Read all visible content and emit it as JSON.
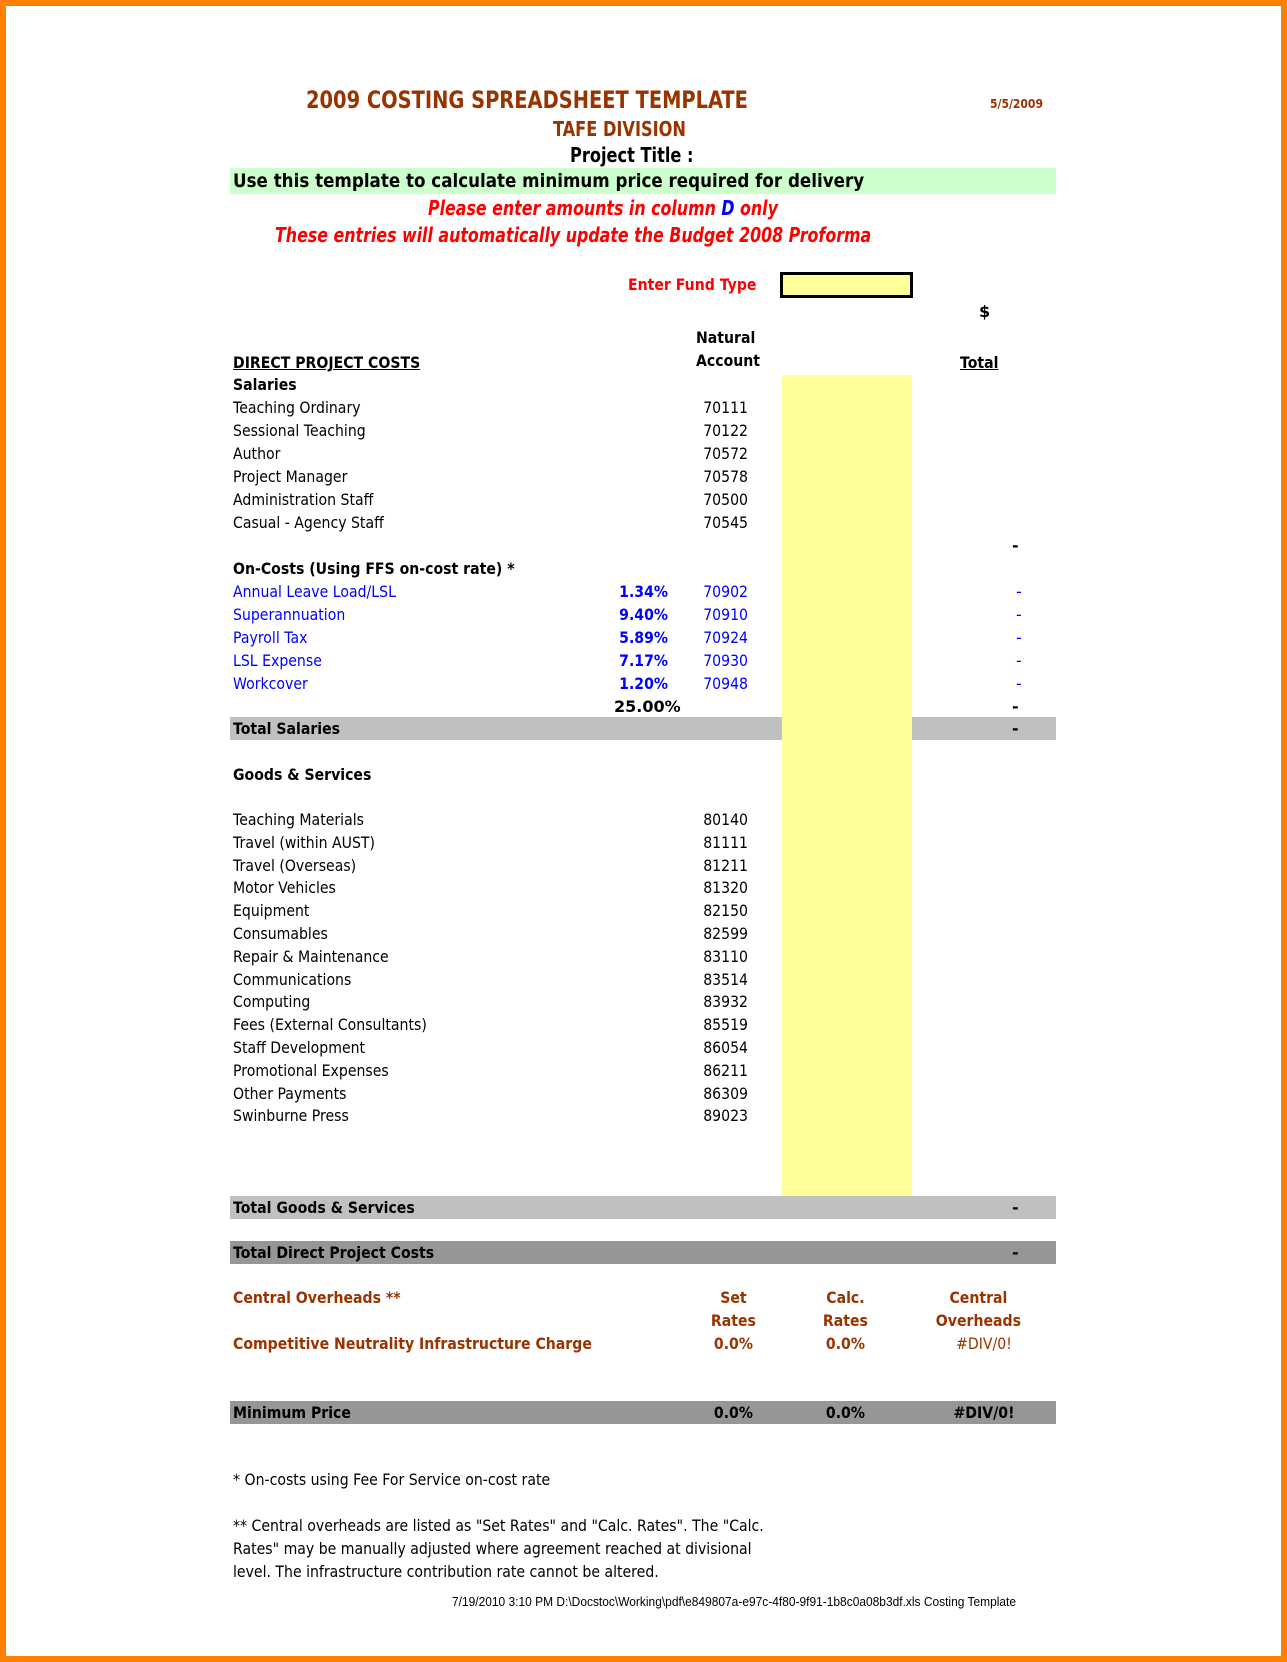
{
  "header": {
    "title": "2009 COSTING SPREADSHEET TEMPLATE",
    "date": "5/5/2009",
    "division": "TAFE DIVISION",
    "project_title_label": "Project Title :",
    "banner": "Use this template to calculate minimum price required for delivery",
    "instruction_prefix": "Please enter amounts in column",
    "instruction_column": "D",
    "instruction_suffix": "only",
    "instruction_2": "These entries will automatically update the Budget 2008 Proforma"
  },
  "fund_type": {
    "label": "Enter Fund Type",
    "value": ""
  },
  "columns": {
    "currency": "$",
    "natural_line1": "Natural",
    "natural_line2": "Account",
    "total": "Total"
  },
  "direct_costs": {
    "heading": "DIRECT PROJECT COSTS",
    "salaries": {
      "heading": "Salaries",
      "items": [
        {
          "label": "Teaching  Ordinary",
          "account": "70111"
        },
        {
          "label": "Sessional Teaching",
          "account": "70122"
        },
        {
          "label": "Author",
          "account": "70572"
        },
        {
          "label": "Project Manager",
          "account": "70578"
        },
        {
          "label": "Administration Staff",
          "account": "70500"
        },
        {
          "label": "Casual - Agency Staff",
          "account": "70545"
        }
      ],
      "subtotal": "-"
    },
    "oncosts": {
      "heading": "On-Costs (Using FFS on-cost rate) *",
      "items": [
        {
          "label": "Annual Leave Load/LSL",
          "rate": "1.34%",
          "account": "70902",
          "total": "-"
        },
        {
          "label": "Superannuation",
          "rate": "9.40%",
          "account": "70910",
          "total": "-"
        },
        {
          "label": "Payroll Tax",
          "rate": "5.89%",
          "account": "70924",
          "total": "-"
        },
        {
          "label": "LSL Expense",
          "rate": "7.17%",
          "account": "70930",
          "total": "-"
        },
        {
          "label": "Workcover",
          "rate": "1.20%",
          "account": "70948",
          "total": "-"
        }
      ],
      "rate_total": "25.00%",
      "subtotal": "-"
    },
    "total_salaries": {
      "label": "Total Salaries",
      "value": "-"
    },
    "goods": {
      "heading": "Goods & Services",
      "items": [
        {
          "label": "Teaching Materials",
          "account": "80140"
        },
        {
          "label": "Travel (within AUST)",
          "account": "81111"
        },
        {
          "label": "Travel (Overseas)",
          "account": "81211"
        },
        {
          "label": "Motor Vehicles",
          "account": "81320"
        },
        {
          "label": "Equipment",
          "account": "82150"
        },
        {
          "label": "Consumables",
          "account": "82599"
        },
        {
          "label": "Repair & Maintenance",
          "account": "83110"
        },
        {
          "label": "Communications",
          "account": "83514"
        },
        {
          "label": "Computing",
          "account": "83932"
        },
        {
          "label": "Fees (External Consultants)",
          "account": "85519"
        },
        {
          "label": "Staff Development",
          "account": "86054"
        },
        {
          "label": "Promotional Expenses",
          "account": "86211"
        },
        {
          "label": "Other Payments",
          "account": "86309"
        },
        {
          "label": "Swinburne Press",
          "account": "89023"
        }
      ]
    },
    "total_goods": {
      "label": "Total Goods & Services",
      "value": "-"
    },
    "total_direct": {
      "label": "Total Direct Project Costs",
      "value": "-"
    }
  },
  "overheads": {
    "heading": "Central Overheads **",
    "col_set_1": "Set",
    "col_set_2": "Rates",
    "col_calc_1": "Calc.",
    "col_calc_2": "Rates",
    "col_central_1": "Central",
    "col_central_2": "Overheads",
    "row": {
      "label": "Competitive Neutrality Infrastructure Charge",
      "set_rate": "0.0%",
      "calc_rate": "0.0%",
      "central": "#DIV/0!"
    }
  },
  "minimum_price": {
    "label": "Minimum Price",
    "set_rate": "0.0%",
    "calc_rate": "0.0%",
    "value": "#DIV/0!"
  },
  "notes": {
    "note1": "*  On-costs using Fee For Service on-cost rate",
    "note2_line1": "** Central overheads are listed as \"Set Rates\" and \"Calc. Rates\". The \"Calc.",
    "note2_line2": "Rates\" may be manually adjusted where agreement reached at divisional",
    "note2_line3": "level. The infrastructure contribution rate cannot be altered."
  },
  "footer": "7/19/2010  3:10 PM  D:\\Docstoc\\Working\\pdf\\e849807a-e97c-4f80-9f91-1b8c0a08b3df.xls  Costing Template"
}
